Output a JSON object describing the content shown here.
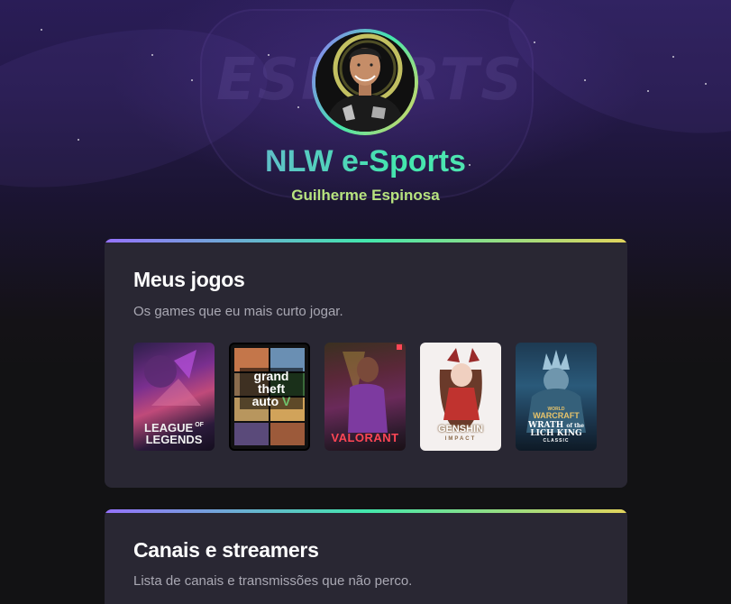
{
  "profile": {
    "site_title": "NLW e-Sports",
    "name": "Guilherme Espinosa",
    "background_text": "ESPORTS"
  },
  "games_card": {
    "title": "Meus jogos",
    "description": "Os games que eu mais curto jogar.",
    "games": [
      {
        "line1": "LEAGUE",
        "of": "OF",
        "line2": "LEGENDS"
      },
      {
        "line1": "grand",
        "line2": "theft",
        "line3": "auto",
        "mark": "V"
      },
      {
        "line1": "VALORANT"
      },
      {
        "line1": "GENSHIN",
        "line2": "IMPACT"
      },
      {
        "line0": "WORLD",
        "line1": "WARCRAFT",
        "line2": "WRATH",
        "line3": "of the",
        "line4": "LICH KING",
        "line5": "CLASSIC"
      }
    ]
  },
  "channels_card": {
    "title": "Canais e streamers",
    "description": "Lista de canais e transmissões que não perco."
  },
  "colors": {
    "background": "#121214",
    "card": "#292733",
    "gradient_purple": "#9572fc",
    "gradient_green": "#43e7ad",
    "gradient_yellow": "#e2d45c",
    "name_color": "#b7e37f"
  }
}
